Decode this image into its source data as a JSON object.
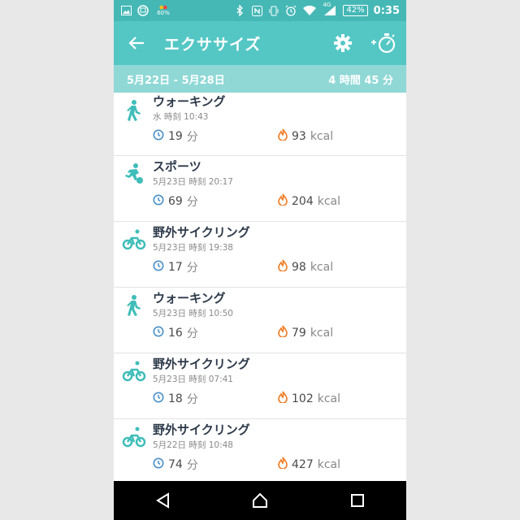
{
  "status_bar": {
    "battery": "42%",
    "time": "0:35",
    "network": "4G",
    "small_label": "60%"
  },
  "app_bar": {
    "title": "エクササイズ"
  },
  "summary": {
    "date_range": "5月22日 - 5月28日",
    "total": "4 時間 45 分"
  },
  "colors": {
    "status_bar": "#45b8b6",
    "app_bar": "#54c7c5",
    "summary_bar": "#8fd8d6",
    "activity_icon": "#3fbdb9",
    "duration_icon": "#4a90c8",
    "calorie_icon": "#f07b24"
  },
  "exercises": [
    {
      "name": "ウォーキング",
      "time": "水 時刻 10:43",
      "duration": "19",
      "duration_unit": "分",
      "calories": "93",
      "calorie_unit": "kcal",
      "icon": "walking-icon"
    },
    {
      "name": "スポーツ",
      "time": "5月23日 時刻 20:17",
      "duration": "69",
      "duration_unit": "分",
      "calories": "204",
      "calorie_unit": "kcal",
      "icon": "sports-icon"
    },
    {
      "name": "野外サイクリング",
      "time": "5月23日 時刻 19:38",
      "duration": "17",
      "duration_unit": "分",
      "calories": "98",
      "calorie_unit": "kcal",
      "icon": "cycling-icon"
    },
    {
      "name": "ウォーキング",
      "time": "5月23日 時刻 10:50",
      "duration": "16",
      "duration_unit": "分",
      "calories": "79",
      "calorie_unit": "kcal",
      "icon": "walking-icon"
    },
    {
      "name": "野外サイクリング",
      "time": "5月23日 時刻 07:41",
      "duration": "18",
      "duration_unit": "分",
      "calories": "102",
      "calorie_unit": "kcal",
      "icon": "cycling-icon"
    },
    {
      "name": "野外サイクリング",
      "time": "5月22日 時刻 10:48",
      "duration": "74",
      "duration_unit": "分",
      "calories": "427",
      "calorie_unit": "kcal",
      "icon": "cycling-icon"
    }
  ]
}
